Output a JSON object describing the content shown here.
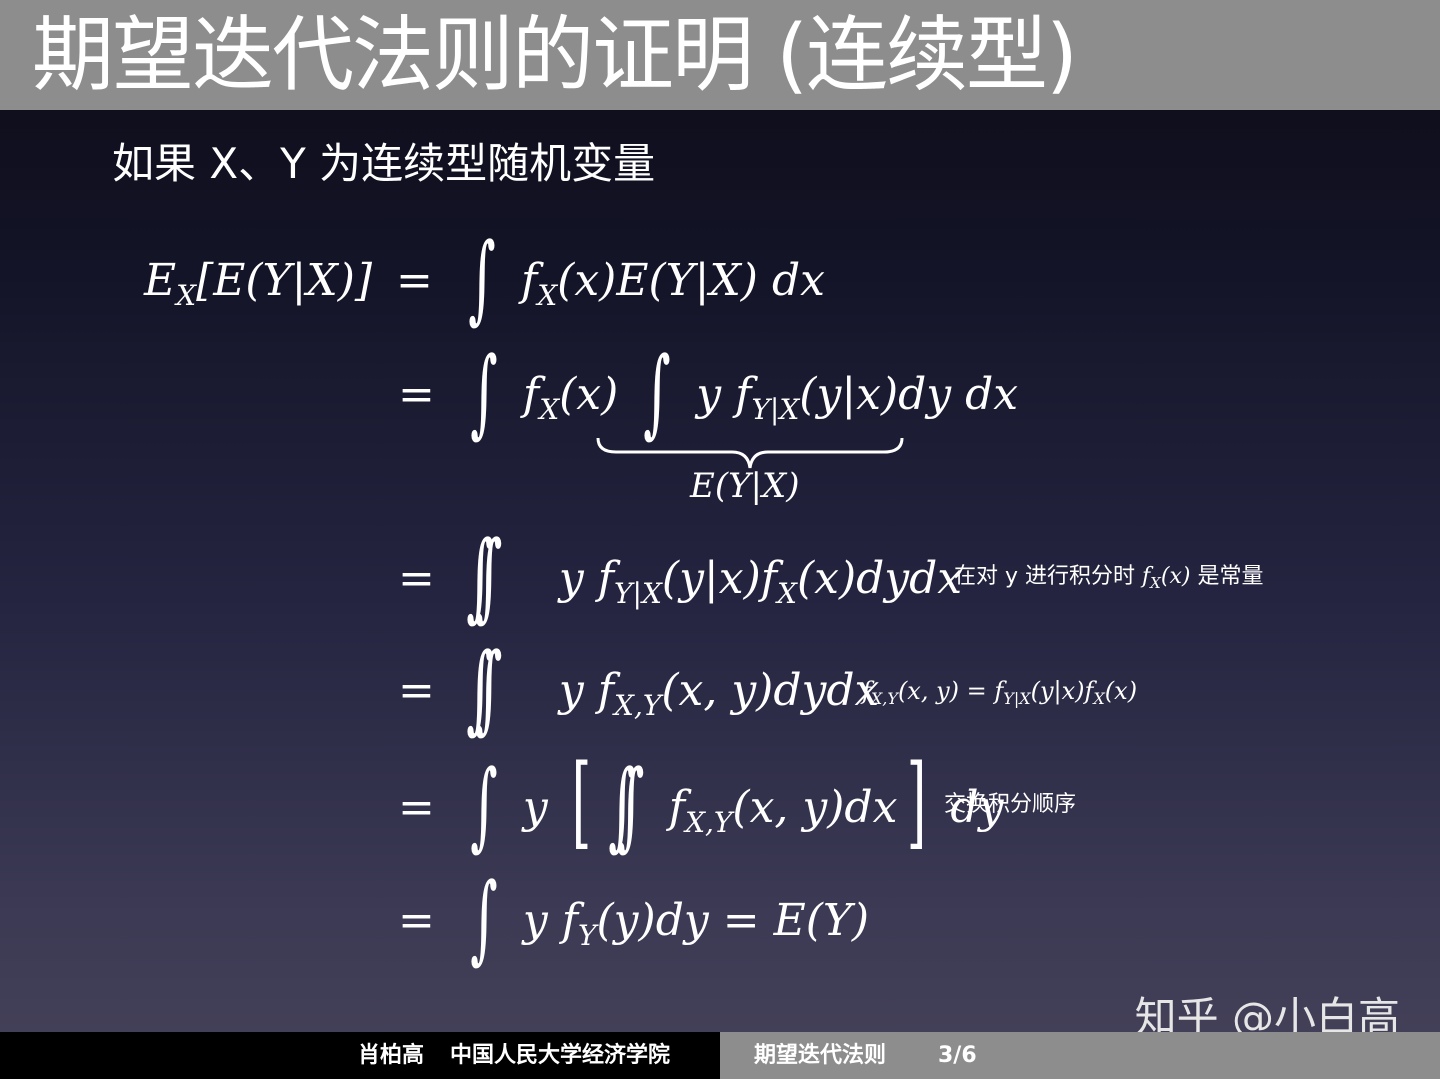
{
  "slide": {
    "title": "期望迭代法则的证明 (连续型)",
    "intro": "如果 X、Y 为连续型随机变量"
  },
  "equations": {
    "line1_lhs": "E",
    "line1_lhs_sub": "X",
    "line1_lhs_rest": "[E(Y|X)]",
    "line1_rhs_a": "f",
    "line1_rhs_a_sub": "X",
    "line1_rhs_b": "(x)E(Y|X) dx",
    "line2_a": "f",
    "line2_a_sub": "X",
    "line2_b": "(x)",
    "line2_c": "y f",
    "line2_c_sub": "Y|X",
    "line2_d": "(y|x)dy dx",
    "brace_label": "E(Y|X)",
    "line3_a": "y f",
    "line3_a_sub": "Y|X",
    "line3_b": "(y|x)f",
    "line3_b_sub": "X",
    "line3_c": "(x)dydx",
    "line4_a": "y f",
    "line4_a_sub": "X,Y",
    "line4_b": "(x, y)dydx",
    "line5_a": "y",
    "line5_b": "f",
    "line5_b_sub": "X,Y",
    "line5_c": "(x, y)dx",
    "line5_d": "dy",
    "line6_a": "y f",
    "line6_a_sub": "Y",
    "line6_b": "(y)dy = E(Y)"
  },
  "notes": {
    "note3_text_a": "在对 y 进行积分时",
    "note3_math": "f",
    "note3_math_sub": "X",
    "note3_math_rest": "(x)",
    "note3_text_b": "是常量",
    "note4_math_a": "f",
    "note4_math_a_sub": "X,Y",
    "note4_math_b": "(x, y) = f",
    "note4_math_b_sub": "Y|X",
    "note4_math_c": "(y|x)f",
    "note4_math_c_sub": "X",
    "note4_math_d": "(x)",
    "note5_text": "交换积分顺序"
  },
  "watermark": "知乎 @小白高",
  "footer": {
    "author": "肖柏高",
    "institution": "中国人民大学经济学院",
    "topic": "期望迭代法则",
    "page": "3/6"
  }
}
